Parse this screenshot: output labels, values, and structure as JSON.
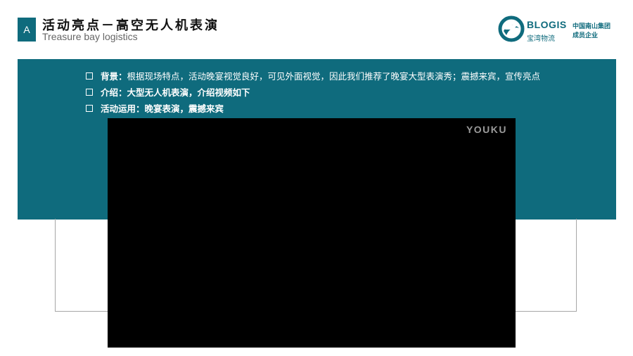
{
  "header": {
    "badge": "A",
    "title": "活动亮点－高空无人机表演",
    "subtitle": "Treasure bay logistics"
  },
  "logo": {
    "name": "BLOGIS",
    "name_cn": "宝湾物流",
    "group_line1": "中国南山集团",
    "group_line2": "成员企业",
    "color": "#0f6b7d"
  },
  "bullets": [
    {
      "label": "背景：",
      "text": "根据现场特点，活动晚宴视觉良好，可见外面视觉，因此我们推荐了晚宴大型表演秀；震撼来宾，宣传亮点"
    },
    {
      "label": "介绍：",
      "text": "大型无人机表演，介绍视频如下"
    },
    {
      "label": "活动运用：",
      "text": "晚宴表演，震撼来宾"
    }
  ],
  "video": {
    "watermark": "YOUKU"
  },
  "colors": {
    "accent": "#0f6b7d",
    "video_bg": "#000000"
  }
}
